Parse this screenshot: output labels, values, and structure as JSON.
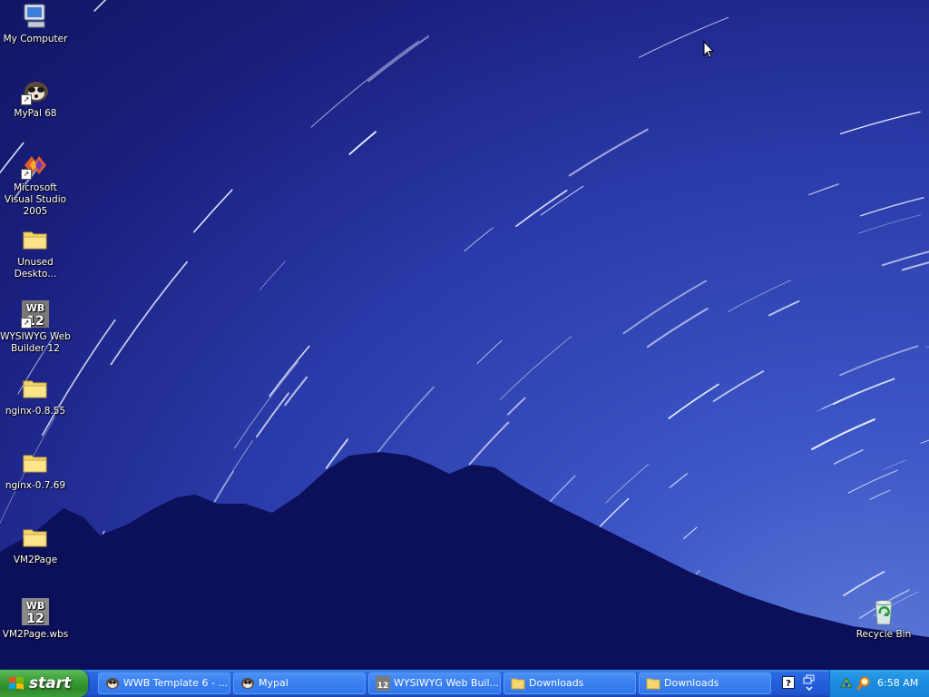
{
  "desktop": {
    "icons": [
      {
        "label": "My Computer",
        "icon": "my-computer-icon"
      },
      {
        "label": "MyPal 68",
        "icon": "mypal-icon"
      },
      {
        "label": "Microsoft Visual Studio 2005",
        "icon": "visual-studio-icon"
      },
      {
        "label": "Unused Deskto...",
        "icon": "folder-icon"
      },
      {
        "label": "WYSIWYG Web Builder 12",
        "icon": "wysiwyg-web-builder-icon",
        "badge": "WB 12"
      },
      {
        "label": "nginx-0.8.55",
        "icon": "folder-icon"
      },
      {
        "label": "nginx-0.7.69",
        "icon": "folder-icon"
      },
      {
        "label": "VM2Page",
        "icon": "folder-icon"
      },
      {
        "label": "VM2Page.wbs",
        "icon": "wbs-file-icon",
        "badge": "WB 12"
      },
      {
        "label": "Recycle Bin",
        "icon": "recycle-bin-icon"
      }
    ]
  },
  "taskbar": {
    "start_label": "start",
    "tasks": [
      {
        "label": "WWB Template 6 - ...",
        "icon": "mypal-icon"
      },
      {
        "label": "Mypal",
        "icon": "mypal-icon"
      },
      {
        "label": "WYSIWYG Web Buil...",
        "icon": "wysiwyg-web-builder-icon"
      },
      {
        "label": "Downloads",
        "icon": "folder-icon"
      },
      {
        "label": "Downloads",
        "icon": "folder-icon"
      }
    ],
    "tray": {
      "clock": "6:58 AM",
      "icons": [
        "help-icon",
        "restore-icon",
        "network-icon",
        "search-icon"
      ]
    }
  },
  "colors": {
    "taskbar_blue": "#245edb",
    "start_green": "#3a9e36",
    "tray_blue": "#1b8be0",
    "sky_dark": "#121663",
    "mountain": "#0c0f5a"
  }
}
